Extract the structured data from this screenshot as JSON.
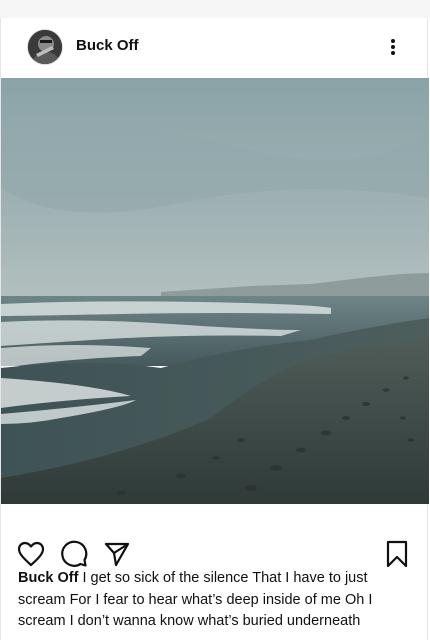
{
  "post": {
    "username": "Buck Off",
    "caption_user": "Buck Off",
    "caption_text": "I get so sick of the silence That I have to just scream For I fear to hear what’s deep inside of me Oh I scream I don’t wanna know what’s buried underneath"
  },
  "icons": {
    "more": "more-vertical-icon",
    "like": "heart-icon",
    "comment": "comment-bubble-icon",
    "share": "send-icon",
    "save": "bookmark-icon"
  }
}
